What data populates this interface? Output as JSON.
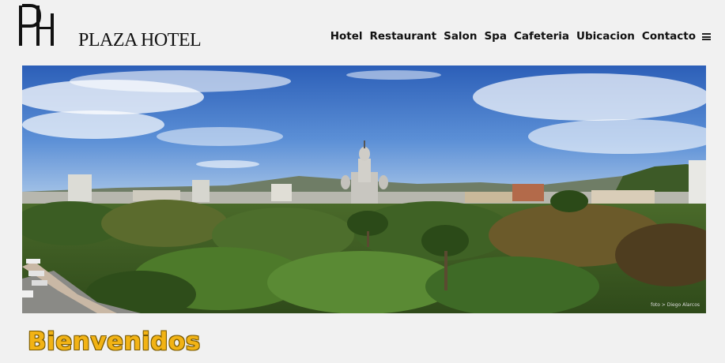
{
  "brand": {
    "name": "PLAZA HOTEL",
    "monogram": "PH"
  },
  "nav": {
    "items": [
      {
        "label": "Hotel"
      },
      {
        "label": "Restaurant"
      },
      {
        "label": "Salon"
      },
      {
        "label": "Spa"
      },
      {
        "label": "Cafeteria"
      },
      {
        "label": "Ubicacion"
      },
      {
        "label": "Contacto"
      }
    ],
    "menu_icon": "hamburger-menu-icon"
  },
  "hero": {
    "photo_credit": "foto > Diego Alarcos"
  },
  "main": {
    "heading": "Bienvenidos"
  },
  "colors": {
    "background": "#f1f1f1",
    "heading": "#f2b315",
    "nav_text": "#111111"
  }
}
